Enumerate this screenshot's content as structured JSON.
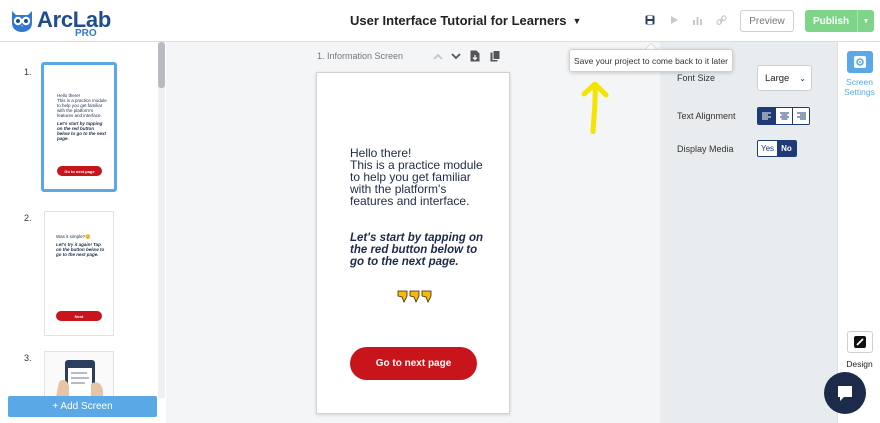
{
  "header": {
    "logo_name": "ArcLab",
    "logo_badge": "PRO",
    "project_title": "User Interface Tutorial for Learners",
    "icons": [
      "save-icon",
      "play-icon",
      "analytics-icon",
      "link-icon"
    ],
    "preview_label": "Preview",
    "publish_label": "Publish"
  },
  "sidebar": {
    "screens": [
      {
        "number": "1.",
        "line1": "Hello there!",
        "line2": "This is a practice module to help you get familiar with the platform's features and interface.",
        "line3": "Let's start by tapping on the red button below to go to the next page.",
        "button": "Go to next page"
      },
      {
        "number": "2.",
        "line1": "Was it simple?😊",
        "line3": "Let's try it again! Tap on the button below to go to the next page.",
        "button": "Next"
      },
      {
        "number": "3."
      }
    ],
    "add_screen_label": "+ Add Screen"
  },
  "canvas": {
    "screen_label": "1.   Information Screen",
    "tools": [
      "chevron-up-icon",
      "chevron-down-icon",
      "export-icon",
      "copy-icon"
    ],
    "body_line1": "Hello there!",
    "body_line2": "This is a practice module to help you get familiar with the platform's features and interface.",
    "body_italic": "Let's start by tapping on the red button below to go to the next page.",
    "emoji": "👇👇👇",
    "button_label": "Go to next page"
  },
  "tooltip": {
    "text": "Save your project to come back to it later"
  },
  "settings": {
    "font_size_label": "Font Size",
    "font_size_value": "Large",
    "text_alignment_label": "Text Alignment",
    "text_alignment_selected": "left",
    "display_media_label": "Display Media",
    "display_media_yes": "Yes",
    "display_media_no": "No",
    "display_media_selected": "No"
  },
  "rail": {
    "screen_settings_label": "Screen Settings",
    "design_label": "Design"
  },
  "colors": {
    "brand_blue": "#1f4e8c",
    "accent_blue": "#5aa9e6",
    "navy": "#1f3b73",
    "cta_red": "#c8151b",
    "publish_green": "#7ed58a",
    "annotation_yellow": "#f5e400"
  }
}
